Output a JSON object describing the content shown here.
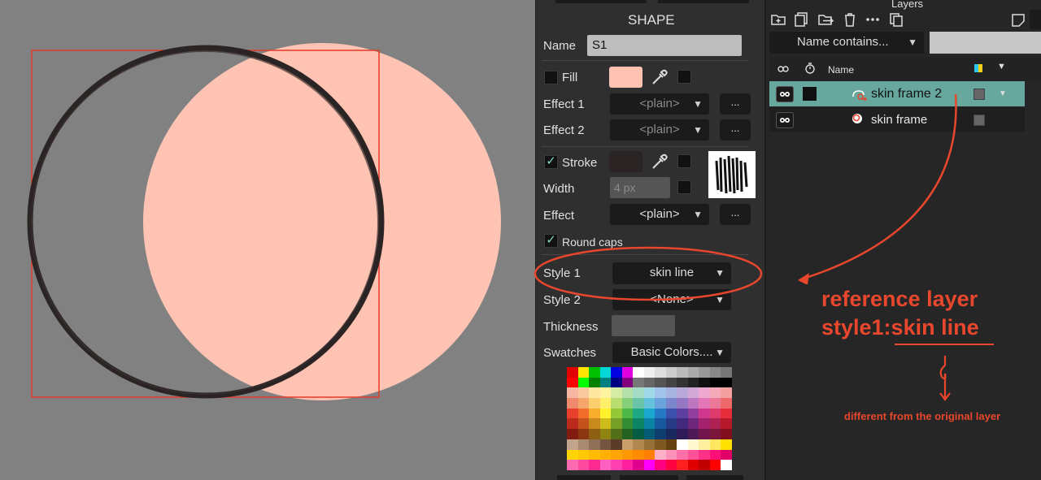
{
  "colors": {
    "accent": "#e8472d",
    "fill": "#ffc3b3",
    "teal": "#67a79d",
    "stroke": "#2b2424"
  },
  "shape_panel": {
    "title": "SHAPE",
    "name_label": "Name",
    "name_value": "S1",
    "fill_label": "Fill",
    "effect1_label": "Effect 1",
    "effect1_value": "<plain>",
    "effect2_label": "Effect 2",
    "effect2_value": "<plain>",
    "more": "...",
    "stroke_label": "Stroke",
    "stroke_checked": "✓",
    "width_label": "Width",
    "width_placeholder": "4 px",
    "effect_label": "Effect",
    "effect_value": "<plain>",
    "round_caps_label": "Round caps",
    "round_caps_checked": "✓",
    "style1_label": "Style 1",
    "style1_value": "skin line",
    "style2_label": "Style 2",
    "style2_value": "<None>",
    "thickness_label": "Thickness",
    "swatches_label": "Swatches",
    "swatches_value": "Basic Colors...."
  },
  "layers_panel": {
    "title": "Layers",
    "filter_value": "Name contains...",
    "col_name": "Name",
    "rows": [
      {
        "name": "skin frame 2",
        "selected": true
      },
      {
        "name": "skin frame",
        "selected": false
      }
    ]
  },
  "annotations": {
    "line1": "reference layer",
    "line2": "style1:skin line",
    "note": "different from the original layer"
  },
  "icons": [
    "add-layer-icon",
    "duplicate-icon",
    "move-icon",
    "trash-icon",
    "more-icon",
    "copy-icon",
    "new-window-icon",
    "eye-icon",
    "timer-icon",
    "eyedropper-icon",
    "chevron-down-icon"
  ]
}
